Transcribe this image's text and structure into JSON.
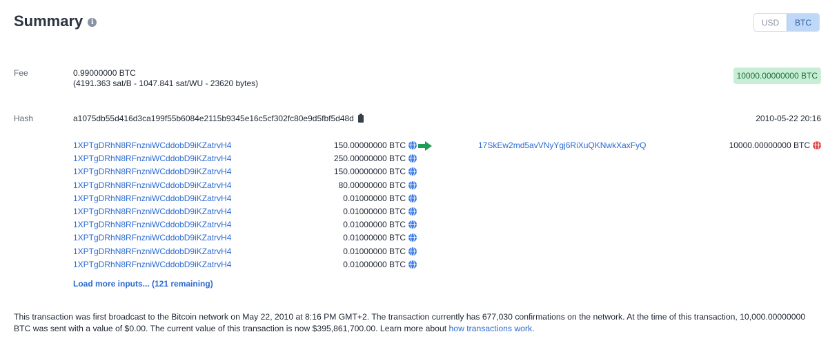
{
  "header": {
    "title": "Summary",
    "info_icon": "i",
    "currency_toggle": {
      "options": [
        "USD",
        "BTC"
      ],
      "selected": "BTC"
    }
  },
  "fee": {
    "label": "Fee",
    "value": "0.99000000 BTC",
    "detail": "(4191.363 sat/B - 1047.841 sat/WU - 23620 bytes)",
    "total_badge": "10000.00000000 BTC",
    "badge_color": "#c8efd5"
  },
  "hash": {
    "label": "Hash",
    "value": "a1075db55d416d3ca199f55b6084e2115b9345e16c5cf302fc80e9d5fbf5d48d",
    "copy_icon": "clipboard-icon",
    "timestamp": "2010-05-22 20:16"
  },
  "inputs": [
    {
      "address": "1XPTgDRhN8RFnzniWCddobD9iKZatrvH4",
      "amount": "150.00000000 BTC"
    },
    {
      "address": "1XPTgDRhN8RFnzniWCddobD9iKZatrvH4",
      "amount": "250.00000000 BTC"
    },
    {
      "address": "1XPTgDRhN8RFnzniWCddobD9iKZatrvH4",
      "amount": "150.00000000 BTC"
    },
    {
      "address": "1XPTgDRhN8RFnzniWCddobD9iKZatrvH4",
      "amount": "80.00000000 BTC"
    },
    {
      "address": "1XPTgDRhN8RFnzniWCddobD9iKZatrvH4",
      "amount": "0.01000000 BTC"
    },
    {
      "address": "1XPTgDRhN8RFnzniWCddobD9iKZatrvH4",
      "amount": "0.01000000 BTC"
    },
    {
      "address": "1XPTgDRhN8RFnzniWCddobD9iKZatrvH4",
      "amount": "0.01000000 BTC"
    },
    {
      "address": "1XPTgDRhN8RFnzniWCddobD9iKZatrvH4",
      "amount": "0.01000000 BTC"
    },
    {
      "address": "1XPTgDRhN8RFnzniWCddobD9iKZatrvH4",
      "amount": "0.01000000 BTC"
    },
    {
      "address": "1XPTgDRhN8RFnzniWCddobD9iKZatrvH4",
      "amount": "0.01000000 BTC"
    }
  ],
  "output": {
    "address": "17SkEw2md5avVNyYgj6RiXuQKNwkXaxFyQ",
    "amount": "10000.00000000 BTC"
  },
  "load_more": "Load more inputs... (121 remaining)",
  "footer": {
    "text": "This transaction was first broadcast to the Bitcoin network on May 22, 2010 at 8:16 PM GMT+2.  The transaction currently has 677,030 confirmations on the network.  At the time of this transaction, 10,000.00000000 BTC was sent with a value of $0.00. The current value of this transaction is now $395,861,700.00.  Learn more about ",
    "link": "how transactions work",
    "end": "."
  },
  "colors": {
    "link": "#2a6ad1",
    "arrow": "#1f9d55",
    "input_globe": "#3b7be6",
    "output_globe": "#e2453c"
  }
}
